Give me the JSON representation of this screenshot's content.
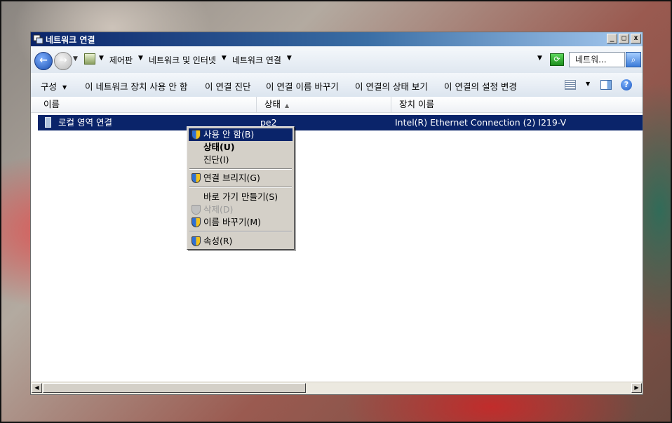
{
  "window": {
    "title": "네트워크 연결",
    "controls": {
      "minimize": "_",
      "maximize": "□",
      "close": "x"
    }
  },
  "address": {
    "breadcrumbs": [
      "제어판",
      "네트워크 및 인터넷",
      "네트워크 연결"
    ],
    "search_placeholder": "네트워...",
    "back_glyph": "←",
    "search_glyph": "⌕"
  },
  "toolbar": {
    "organize_label": "구성",
    "commands": [
      "이 네트워크 장치 사용 안 함",
      "이 연결 진단",
      "이 연결 이름 바꾸기",
      "이 연결의 상태 보기",
      "이 연결의 설정 변경"
    ],
    "help_glyph": "?"
  },
  "columns": [
    "이름",
    "상태",
    "장치 이름"
  ],
  "rows": [
    {
      "name": "로컬 영역 연결",
      "status": "pe2",
      "device": "Intel(R) Ethernet Connection (2) I219-V"
    }
  ],
  "context_menu": {
    "items": [
      {
        "label": "사용 안 함(B)",
        "shield": true,
        "highlighted": true
      },
      {
        "label": "상태(U)",
        "bold": true
      },
      {
        "label": "진단(I)"
      },
      {
        "label": "연결 브리지(G)",
        "shield": true
      },
      {
        "label": "바로 가기 만들기(S)"
      },
      {
        "label": "삭제(D)",
        "shield": true,
        "disabled": true
      },
      {
        "label": "이름 바꾸기(M)",
        "shield": true
      },
      {
        "label": "속성(R)",
        "shield": true
      }
    ]
  },
  "colors": {
    "selection": "#0a246a",
    "menu_bg": "#d4d0c8",
    "title_start": "#0a246a",
    "title_end": "#a6caf0"
  }
}
